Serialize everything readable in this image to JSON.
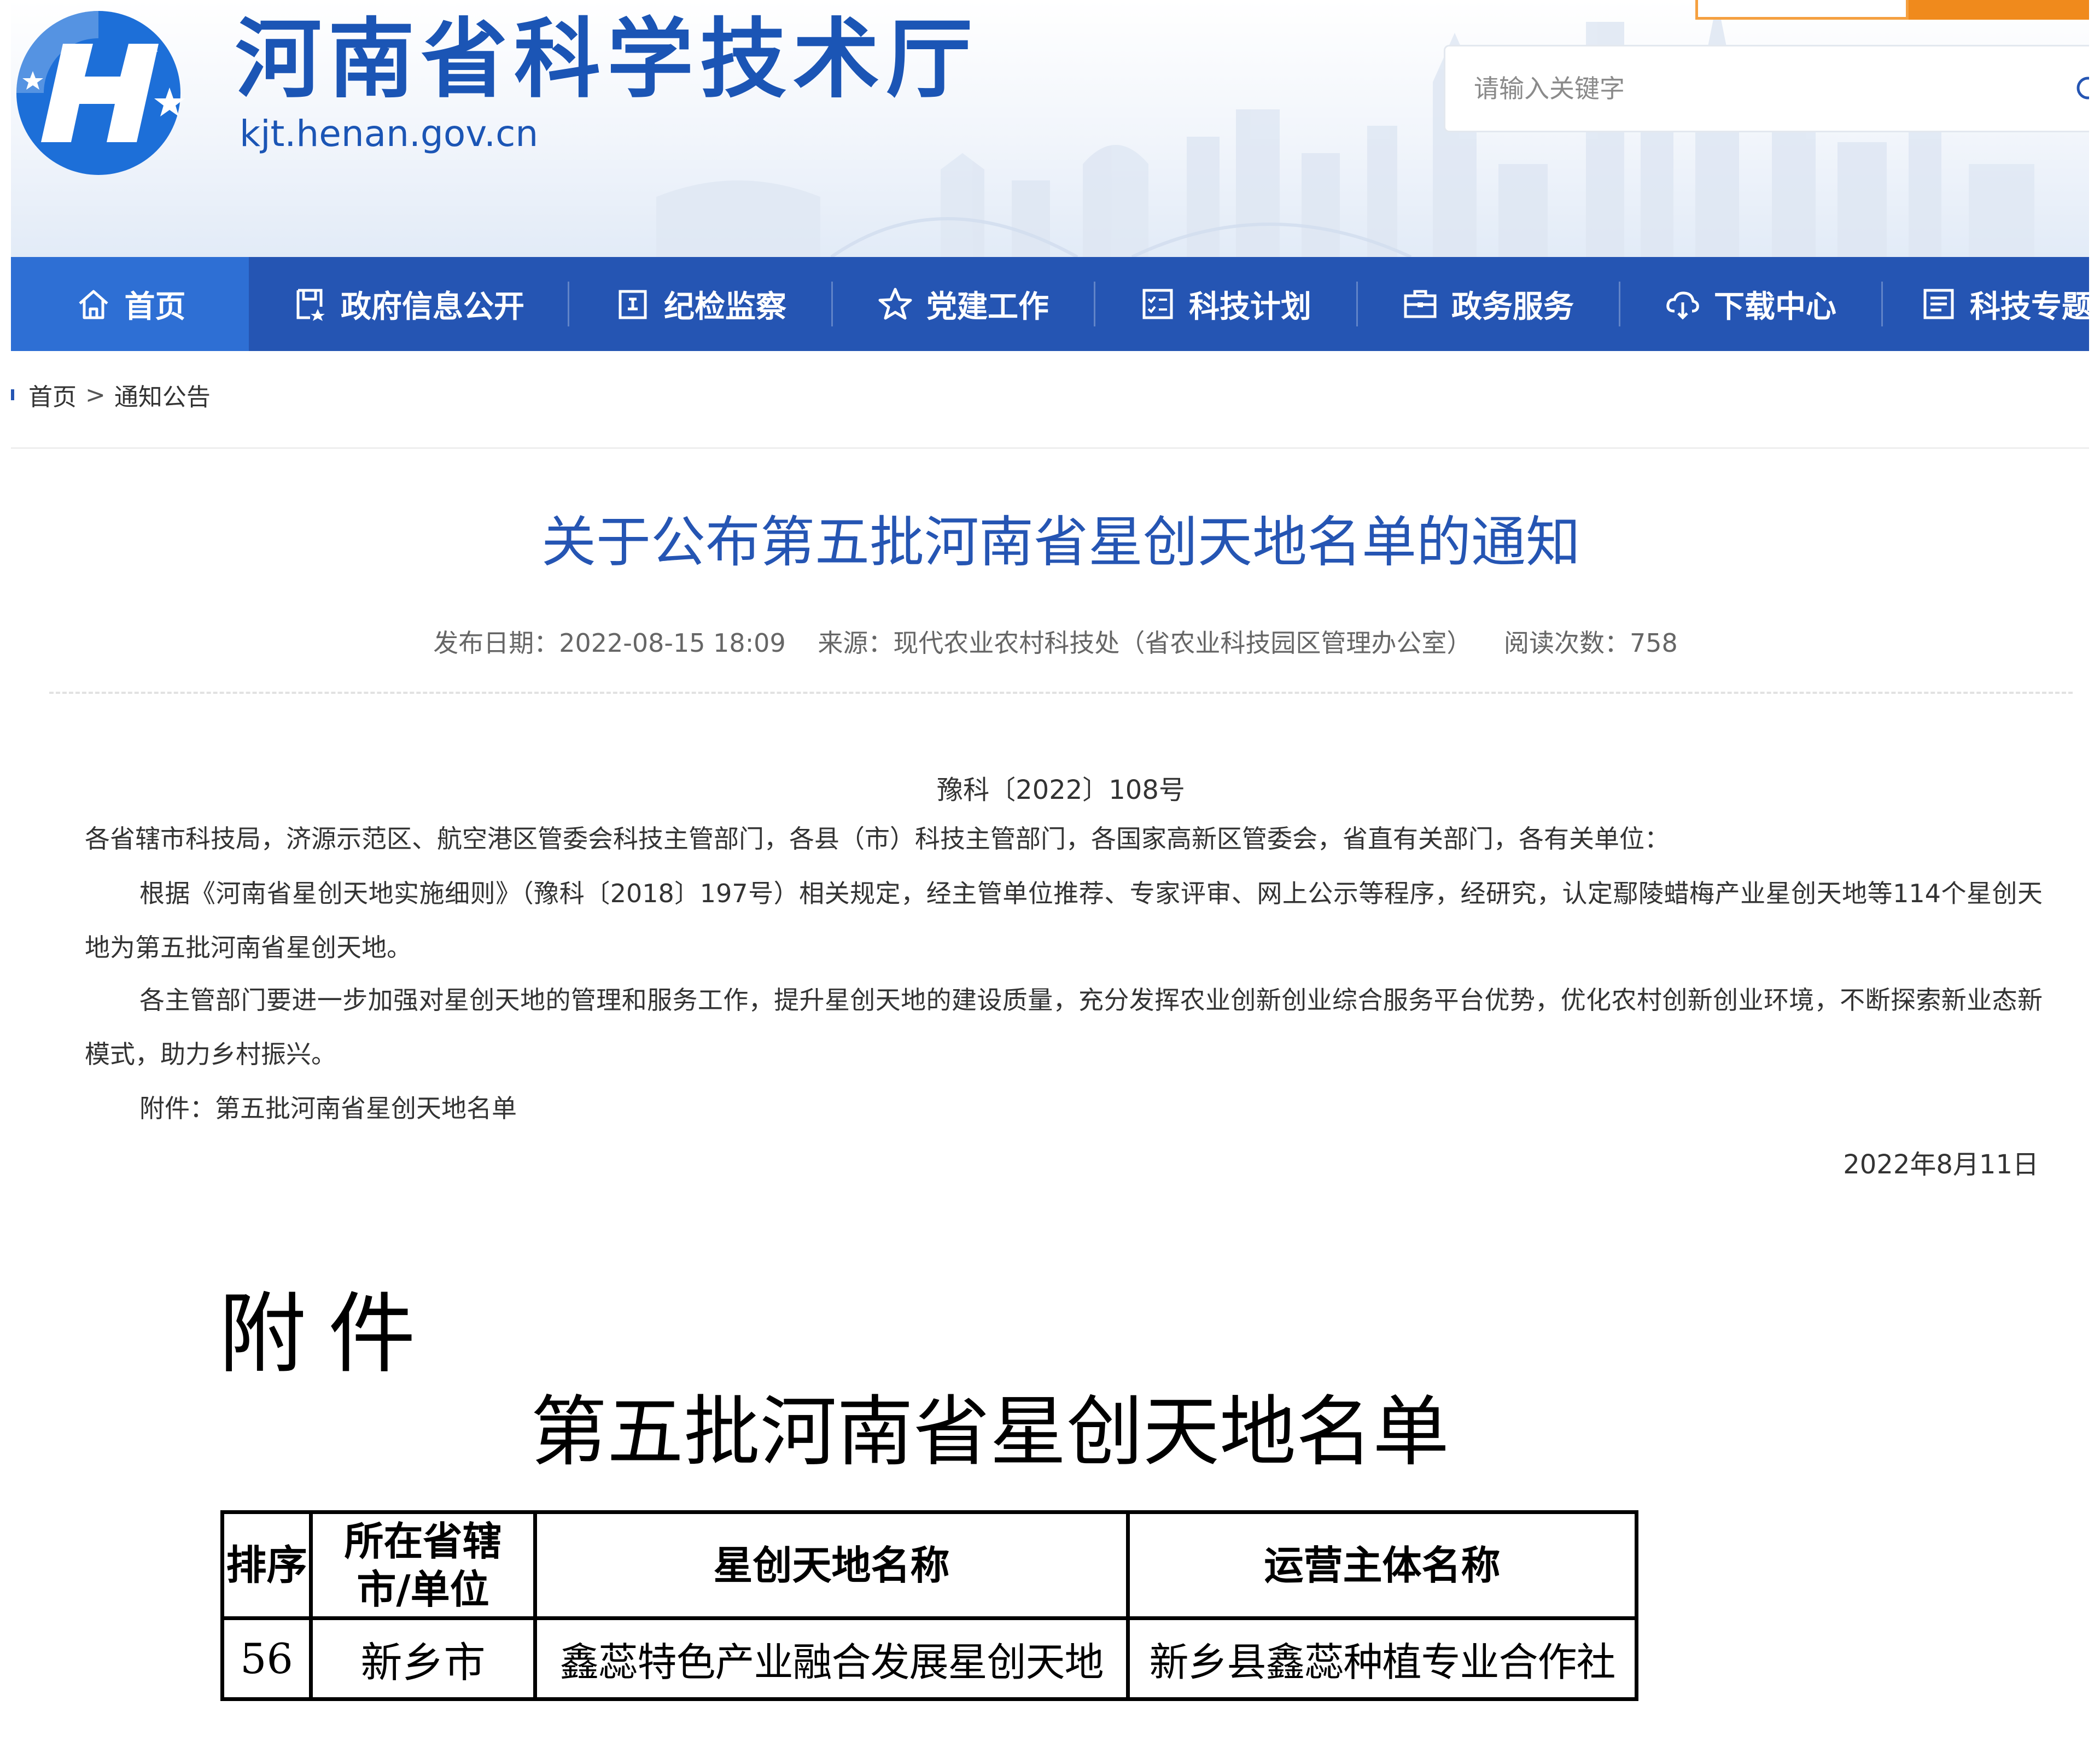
{
  "header": {
    "site_title": "河南省科学技术厅",
    "site_domain": "kjt.henan.gov.cn",
    "search_placeholder": "请输入关键字",
    "colors": {
      "brand_blue": "#2555b3",
      "title_blue": "#1b55b5",
      "accent_orange": "#f08a1c"
    }
  },
  "nav": {
    "items": [
      {
        "label": "首页",
        "icon": "home-icon",
        "active": true
      },
      {
        "label": "政府信息公开",
        "icon": "document-icon"
      },
      {
        "label": "纪检监察",
        "icon": "badge-icon"
      },
      {
        "label": "党建工作",
        "icon": "star-icon"
      },
      {
        "label": "科技计划",
        "icon": "checklist-icon"
      },
      {
        "label": "政务服务",
        "icon": "briefcase-icon"
      },
      {
        "label": "下载中心",
        "icon": "cloud-download-icon"
      },
      {
        "label": "科技专题",
        "icon": "list-icon"
      }
    ]
  },
  "breadcrumb": {
    "home": "首页",
    "separator": ">",
    "current": "通知公告"
  },
  "article": {
    "title": "关于公布第五批河南省星创天地名单的通知",
    "meta": {
      "publish_date": "发布日期：2022-08-15 18:09",
      "source": "来源：现代农业农村科技处（省农业科技园区管理办公室）",
      "views": "阅读次数：758"
    },
    "doc_no": "豫科〔2022〕108号",
    "paragraphs": [
      "各省辖市科技局，济源示范区、航空港区管委会科技主管部门，各县（市）科技主管部门，各国家高新区管委会，省直有关部门，各有关单位：",
      "根据《河南省星创天地实施细则》（豫科〔2018〕197号）相关规定，经主管单位推荐、专家评审、网上公示等程序，经研究，认定鄢陵蜡梅产业星创天地等114个星创天地为第五批河南省星创天地。",
      "各主管部门要进一步加强对星创天地的管理和服务工作，提升星创天地的建设质量，充分发挥农业创新创业综合服务平台优势，优化农村创新创业环境，不断探索新业态新模式，助力乡村振兴。",
      "附件：第五批河南省星创天地名单"
    ],
    "date": "2022年8月11日"
  },
  "attachment": {
    "label": "附件",
    "title": "第五批河南省星创天地名单",
    "table": {
      "headers": [
        "排序",
        "所在省辖市/单位",
        "星创天地名称",
        "运营主体名称"
      ],
      "header_lines": {
        "col2_line1": "所在省辖",
        "col2_line2": "市/单位"
      },
      "rows": [
        [
          "56",
          "新乡市",
          "鑫蕊特色产业融合发展星创天地",
          "新乡县鑫蕊种植专业合作社"
        ]
      ]
    }
  }
}
